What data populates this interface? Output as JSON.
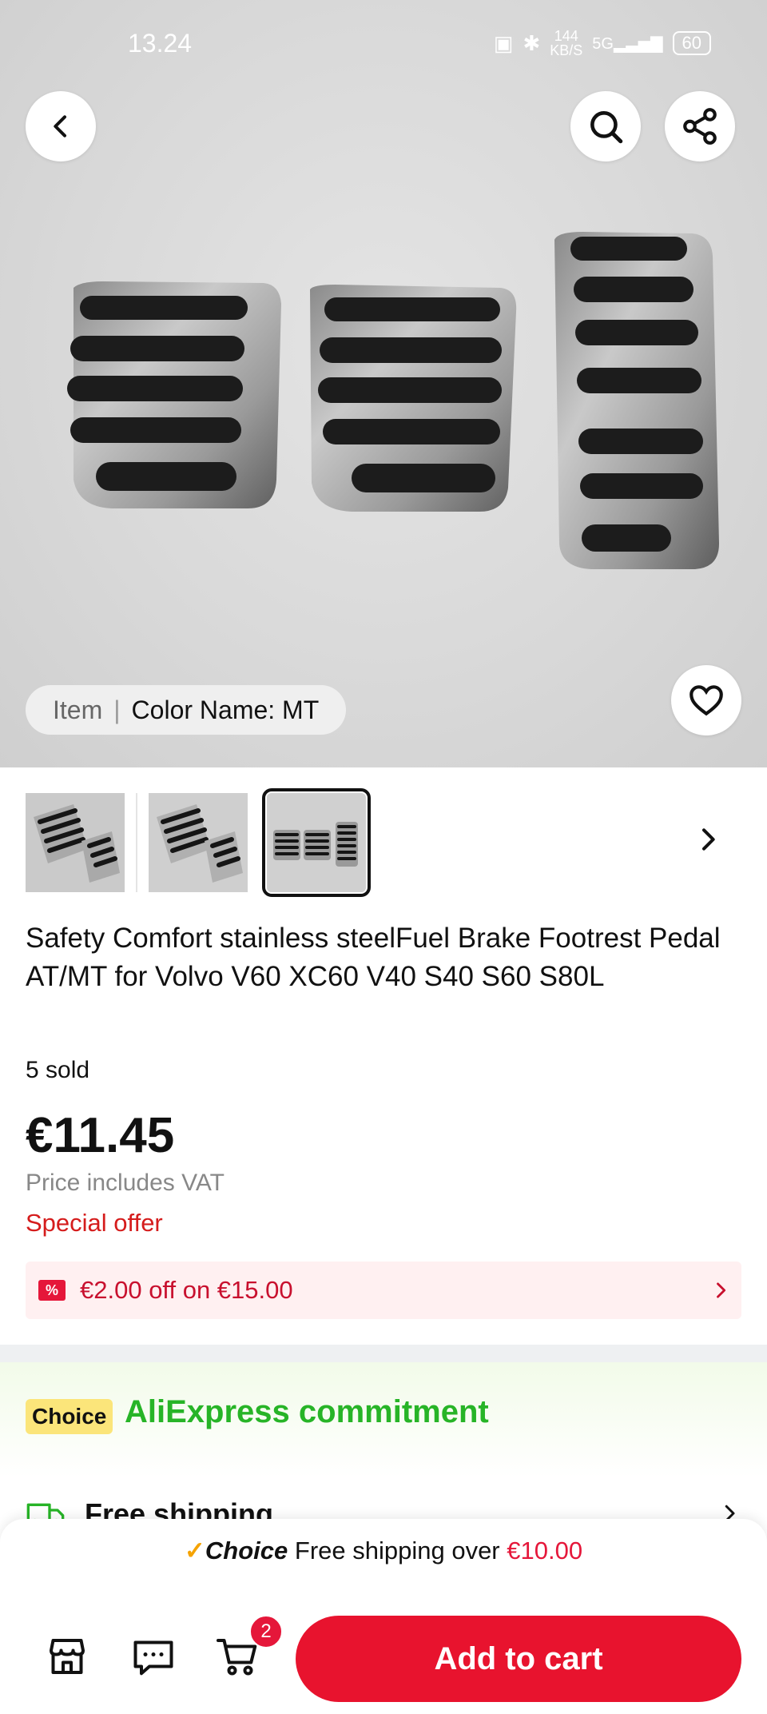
{
  "status_bar": {
    "time": "13.24",
    "network_speed": "144",
    "network_unit": "KB/S",
    "signal_label": "5G",
    "battery": "60"
  },
  "hero": {
    "variant_label": "Item",
    "variant_value": "Color Name: MT",
    "icons": [
      "back-icon",
      "search-icon",
      "share-icon",
      "heart-icon"
    ]
  },
  "gallery": {
    "thumbnail_count": 3,
    "selected_index": 2
  },
  "product": {
    "title": "Safety Comfort stainless steelFuel Brake Footrest Pedal AT/MT for Volvo V60 XC60 V40 S40 S60 S80L",
    "sold": "5 sold",
    "price": "€11.45",
    "vat_note": "Price includes VAT",
    "special_offer": "Special offer",
    "coupon_icon": "%",
    "coupon_text": "€2.00 off on €15.00"
  },
  "commitment": {
    "badge": "Choice",
    "title": "AliExpress commitment",
    "free_shipping": "Free shipping"
  },
  "bottom": {
    "choice_check": "✓",
    "choice_brand": "Choice",
    "choice_text": " Free shipping over ",
    "choice_amount": "€10.00",
    "cart_count": "2",
    "add_to_cart": "Add to cart"
  },
  "colors": {
    "accent_red": "#e8132e",
    "choice_green": "#27b427",
    "choice_yellow": "#fbe57a"
  }
}
